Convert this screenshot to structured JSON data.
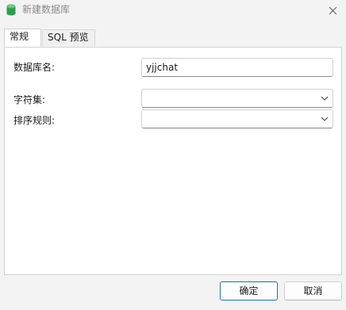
{
  "window": {
    "title": "新建数据库",
    "close_icon": "close-icon",
    "app_icon": "database-icon",
    "app_icon_color": "#2e9e4a"
  },
  "tabs": [
    {
      "label": "常规",
      "active": true
    },
    {
      "label": "SQL 预览",
      "active": false
    }
  ],
  "form": {
    "db_name_label": "数据库名:",
    "db_name_value": "yjjchat",
    "charset_label": "字符集:",
    "charset_value": "",
    "collation_label": "排序规则:",
    "collation_value": ""
  },
  "buttons": {
    "ok_label": "确定",
    "cancel_label": "取消"
  },
  "colors": {
    "window_bg": "#f3f3f3",
    "panel_bg": "#ffffff",
    "primary_border": "#1f6fb8"
  }
}
